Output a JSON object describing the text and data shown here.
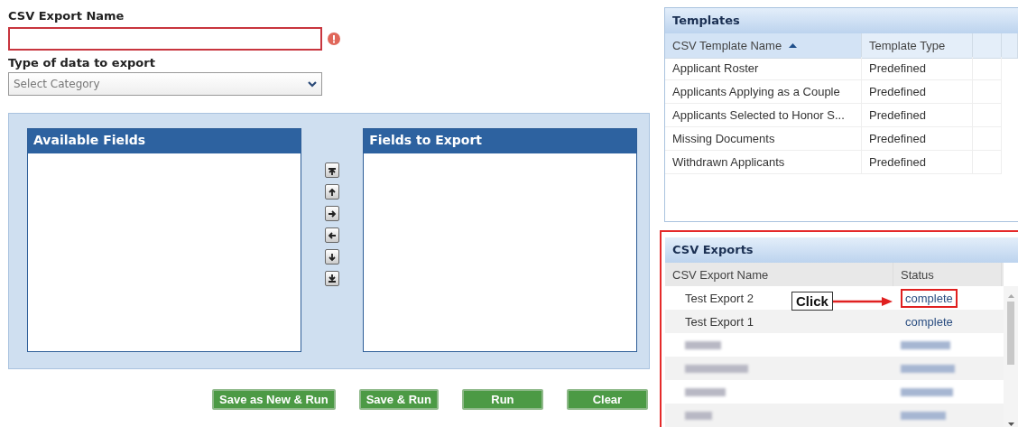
{
  "export_name": {
    "label": "CSV Export Name",
    "invalid": true
  },
  "data_type": {
    "label": "Type of data to export",
    "placeholder": "Select Category"
  },
  "available_fields": {
    "title": "Available Fields"
  },
  "fields_to_export": {
    "title": "Fields to Export"
  },
  "move_buttons": [
    {
      "kind": "top"
    },
    {
      "kind": "up"
    },
    {
      "kind": "right"
    },
    {
      "kind": "left"
    },
    {
      "kind": "down"
    },
    {
      "kind": "bottom"
    }
  ],
  "actions": [
    "Save as New & Run",
    "Save & Run",
    "Run",
    "Clear"
  ],
  "templates": {
    "title": "Templates",
    "columns": [
      {
        "label": "CSV Template Name",
        "sorted": true
      },
      {
        "label": "Template Type",
        "sorted": false
      }
    ],
    "rows": [
      [
        "Applicant Roster",
        "Predefined"
      ],
      [
        "Applicants Applying as a Couple",
        "Predefined"
      ],
      [
        "Applicants Selected to Honor S...",
        "Predefined"
      ],
      [
        "Missing Documents",
        "Predefined"
      ],
      [
        "Withdrawn Applicants",
        "Predefined"
      ]
    ]
  },
  "csv_exports": {
    "title": "CSV Exports",
    "columns": [
      "CSV Export Name",
      "Status"
    ],
    "highlighted": true,
    "rows": [
      {
        "kind": "text",
        "name": "Test Export 2",
        "status": "complete",
        "highlighted": true
      },
      {
        "kind": "text",
        "name": "Test Export 1",
        "status": "complete",
        "highlighted": false
      },
      {
        "kind": "redacted"
      },
      {
        "kind": "redacted"
      },
      {
        "kind": "redacted"
      },
      {
        "kind": "redacted"
      }
    ]
  },
  "callout": {
    "label": "Click"
  }
}
